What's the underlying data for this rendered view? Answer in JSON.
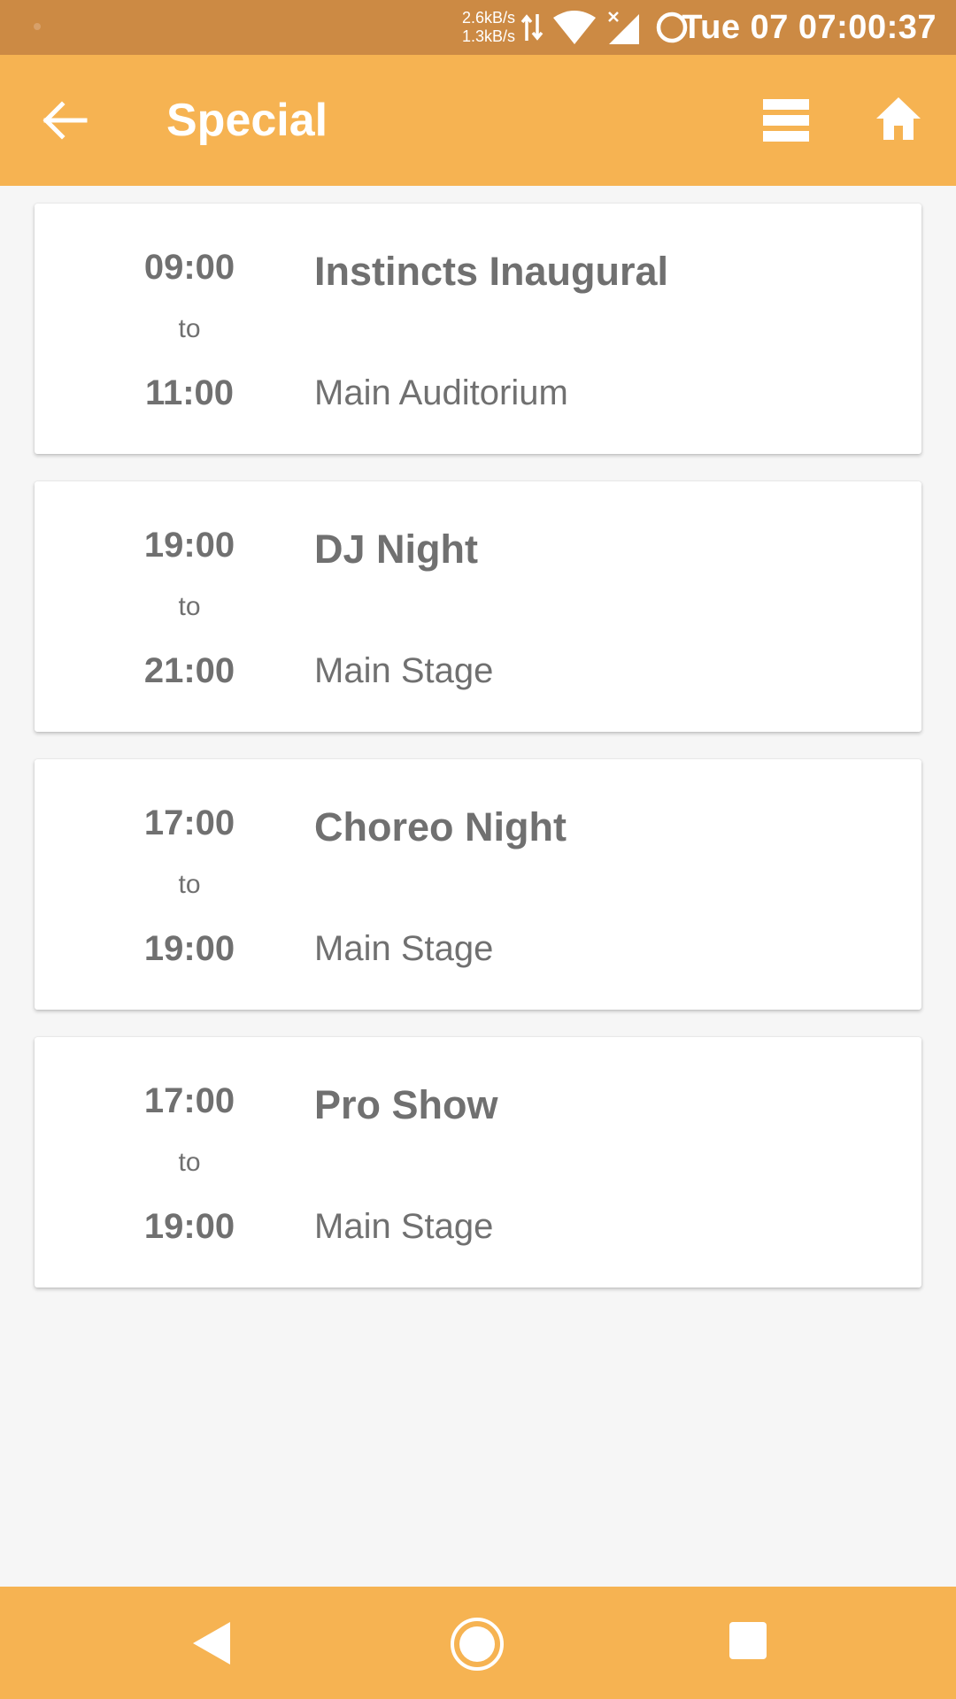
{
  "status_bar": {
    "net_up": "2.6kB/s",
    "net_down": "1.3kB/s",
    "clock": "Tue 07 07:00:37",
    "icons": [
      "net-activity-icon",
      "wifi-icon",
      "signal-icon",
      "sync-icon"
    ]
  },
  "app_bar": {
    "title": "Special",
    "back_icon": "arrow-back-icon",
    "view_icon": "view-agenda-icon",
    "home_icon": "home-icon"
  },
  "events": [
    {
      "start": "09:00",
      "sep": "to",
      "end": "11:00",
      "title": "Instincts Inaugural",
      "venue": "Main Auditorium"
    },
    {
      "start": "19:00",
      "sep": "to",
      "end": "21:00",
      "title": "DJ Night",
      "venue": "Main Stage"
    },
    {
      "start": "17:00",
      "sep": "to",
      "end": "19:00",
      "title": "Choreo Night",
      "venue": "Main Stage"
    },
    {
      "start": "17:00",
      "sep": "to",
      "end": "19:00",
      "title": "Pro Show",
      "venue": "Main Stage"
    }
  ],
  "nav_bar": {
    "icons": [
      "nav-back-icon",
      "nav-home-icon",
      "nav-recents-icon"
    ]
  },
  "colors": {
    "status_bar": "#cc8a44",
    "app_bar": "#f6b352",
    "nav_bar": "#f6b352",
    "background": "#f6f6f6",
    "card": "#ffffff",
    "text": "#707070"
  }
}
